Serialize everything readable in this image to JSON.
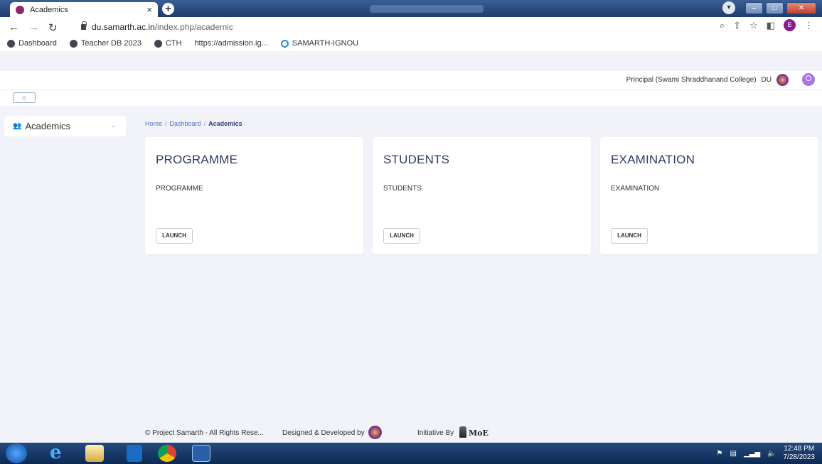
{
  "browser": {
    "tab_title": "Academics",
    "tab_close": "×",
    "new_tab": "+",
    "url_host": "du.samarth.ac.in",
    "url_path": "/index.php/academic",
    "profile_initial": "E",
    "bookmarks": [
      {
        "label": "Dashboard",
        "icon": "samarth-icon"
      },
      {
        "label": "Teacher DB 2023",
        "icon": "globe-icon"
      },
      {
        "label": "CTH",
        "icon": "globe-icon"
      },
      {
        "label": "https://admission.ig...",
        "icon": "none"
      },
      {
        "label": "SAMARTH-IGNOU",
        "icon": "ignou-icon"
      }
    ]
  },
  "header": {
    "user_role": "Principal (Swami Shraddhanand College)",
    "university": "DU"
  },
  "sidebar": {
    "items": [
      {
        "label": "Academics"
      }
    ]
  },
  "breadcrumb": {
    "home": "Home",
    "dashboard": "Dashboard",
    "current": "Academics"
  },
  "cards": [
    {
      "title": "PROGRAMME",
      "subtitle": "PROGRAMME",
      "button": "LAUNCH"
    },
    {
      "title": "STUDENTS",
      "subtitle": "STUDENTS",
      "button": "LAUNCH"
    },
    {
      "title": "EXAMINATION",
      "subtitle": "EXAMINATION",
      "button": "LAUNCH"
    }
  ],
  "footer": {
    "copyright": "© Project Samarth - All Rights Rese...",
    "designed": "Designed & Developed by",
    "initiative": "Initiative By",
    "moe": "MoE"
  },
  "taskbar": {
    "time": "12:48 PM",
    "date": "7/28/2023"
  },
  "colors": {
    "accent": "#2e3b67",
    "link": "#5370c0",
    "background": "#f1f3f9"
  }
}
